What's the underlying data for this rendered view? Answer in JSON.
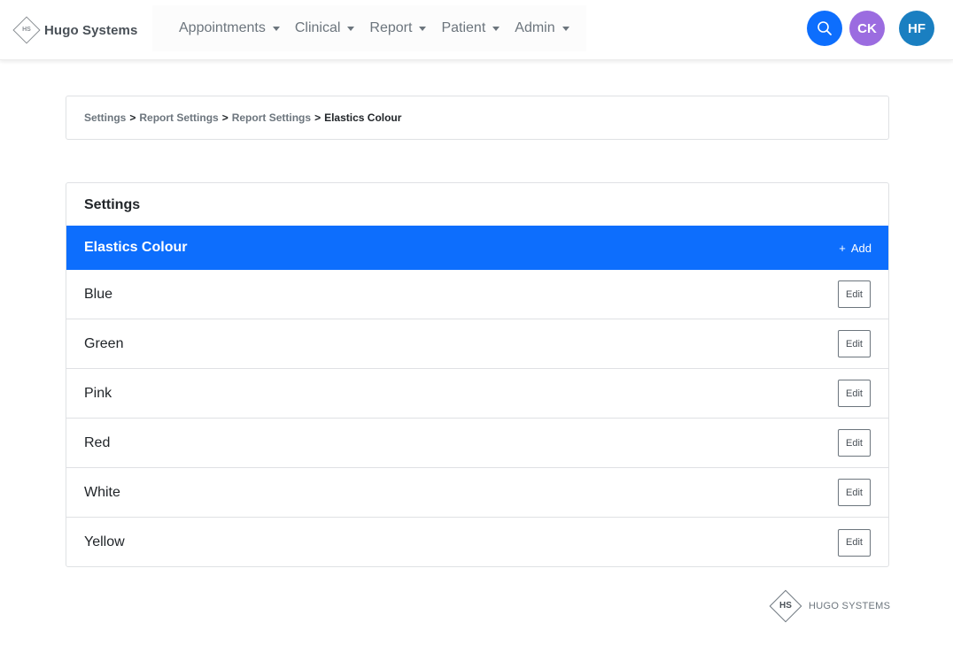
{
  "brand": {
    "logo_text": "HS",
    "name": "Hugo Systems"
  },
  "nav": {
    "items": [
      {
        "label": "Appointments"
      },
      {
        "label": "Clinical"
      },
      {
        "label": "Report"
      },
      {
        "label": "Patient"
      },
      {
        "label": "Admin"
      }
    ]
  },
  "header_actions": {
    "search_icon": "search-icon",
    "avatars": [
      {
        "initials": "CK",
        "color": "#9b6ce0"
      },
      {
        "initials": "HF",
        "color": "#1a7fc1"
      }
    ],
    "search_color": "#0d6efd"
  },
  "breadcrumb": {
    "items": [
      "Settings",
      "Report Settings",
      "Report Settings"
    ],
    "separator": ">",
    "current": "Elastics Colour"
  },
  "card": {
    "title": "Settings",
    "section_title": "Elastics Colour",
    "add_label": "Add",
    "add_icon": "plus-icon",
    "accent_color": "#0d6efd",
    "rows": [
      {
        "label": "Blue",
        "action": "Edit"
      },
      {
        "label": "Green",
        "action": "Edit"
      },
      {
        "label": "Pink",
        "action": "Edit"
      },
      {
        "label": "Red",
        "action": "Edit"
      },
      {
        "label": "White",
        "action": "Edit"
      },
      {
        "label": "Yellow",
        "action": "Edit"
      }
    ]
  },
  "footer": {
    "logo_text": "HS",
    "name": "HUGO SYSTEMS"
  }
}
